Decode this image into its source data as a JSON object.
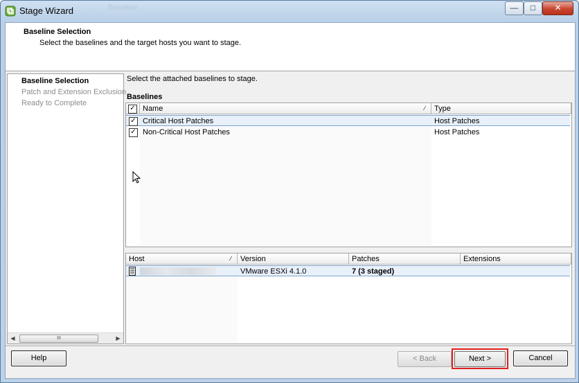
{
  "window": {
    "title": "Stage Wizard",
    "ghost_title_fragment": "Baseline"
  },
  "header": {
    "title": "Baseline Selection",
    "subtitle": "Select the baselines and the target hosts you want to stage."
  },
  "nav": {
    "items": [
      {
        "label": "Baseline Selection",
        "active": true
      },
      {
        "label": "Patch and Extension Exclusion",
        "active": false
      },
      {
        "label": "Ready to Complete",
        "active": false
      }
    ],
    "scroll_grip": "III"
  },
  "main": {
    "instruction": "Select the attached baselines to stage.",
    "baselines_label": "Baselines",
    "baselines_table": {
      "columns": [
        "Name",
        "Type"
      ],
      "rows": [
        {
          "checked": true,
          "name": "Critical Host Patches",
          "type": "Host Patches"
        },
        {
          "checked": true,
          "name": "Non-Critical Host Patches",
          "type": "Host Patches"
        }
      ]
    },
    "hosts_table": {
      "columns": [
        "Host",
        "Version",
        "Patches",
        "Extensions"
      ],
      "rows": [
        {
          "host": "",
          "version": "VMware ESXi 4.1.0",
          "patches": "7 (3 staged)",
          "extensions": ""
        }
      ]
    }
  },
  "buttons": {
    "help": "Help",
    "back": "< Back",
    "next": "Next >",
    "cancel": "Cancel"
  },
  "colors": {
    "highlight": "#e0201c",
    "selection": "#e8f0fa"
  }
}
